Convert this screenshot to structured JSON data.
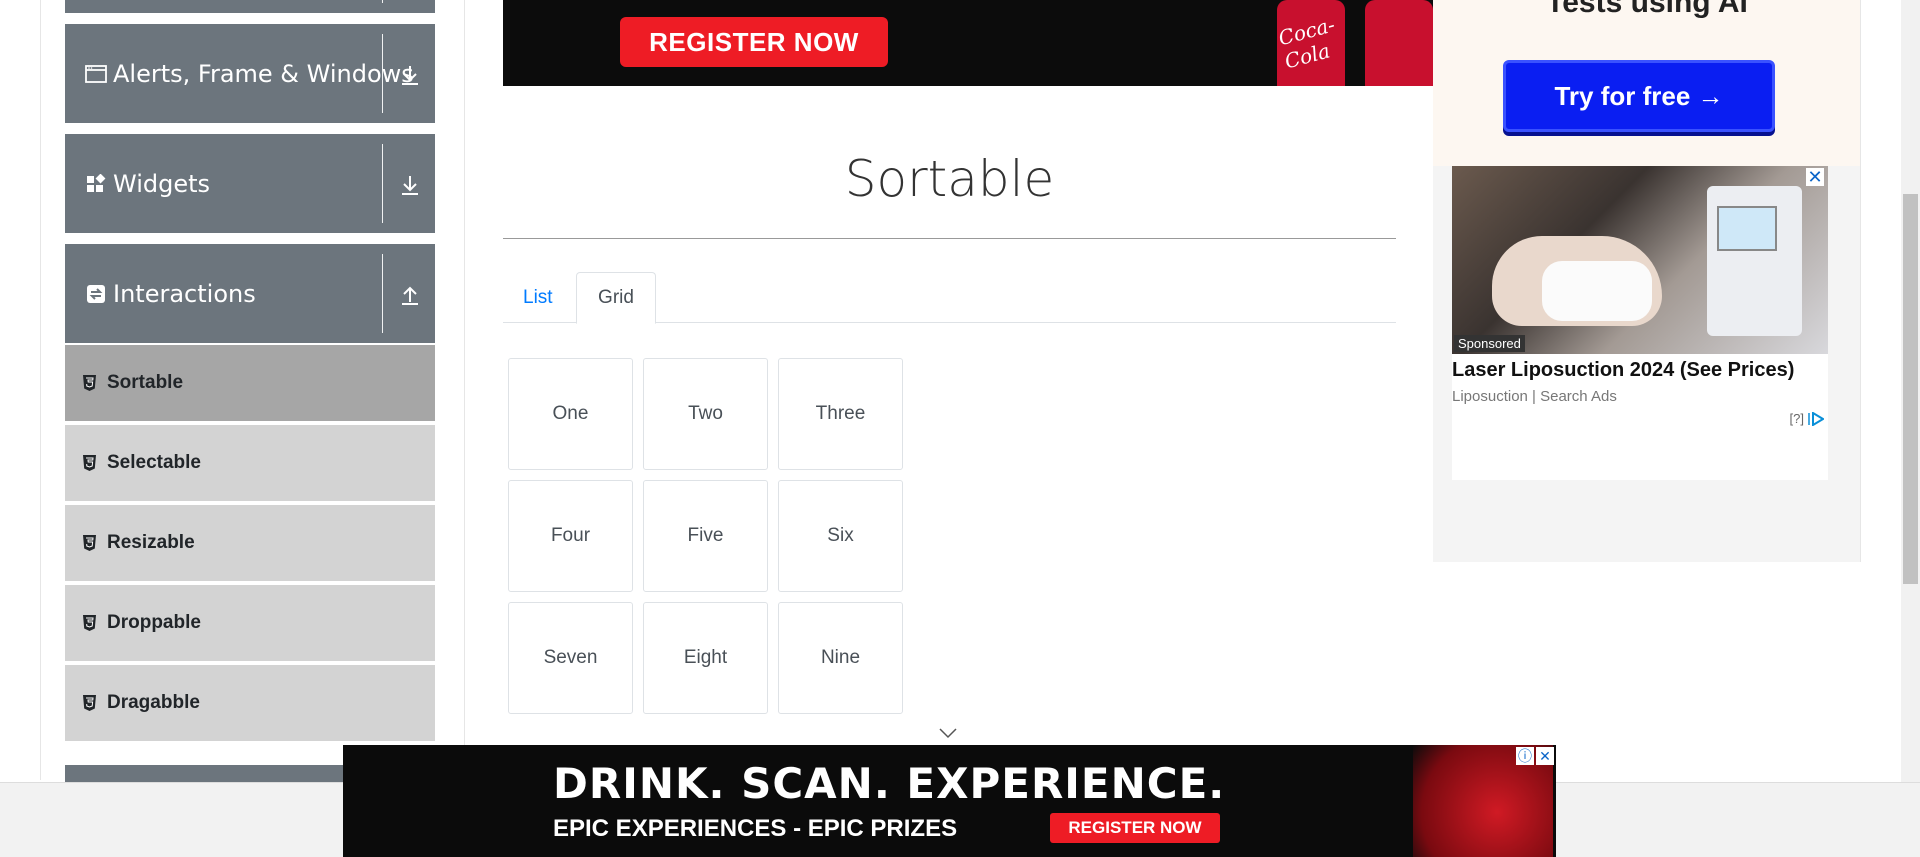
{
  "sidebar": {
    "groups": [
      {
        "label": "Alerts, Frame & Windows",
        "icon": "window-icon",
        "toggle_icon": "download-arrow-icon"
      },
      {
        "label": "Widgets",
        "icon": "widgets-grid-icon",
        "toggle_icon": "download-arrow-icon"
      },
      {
        "label": "Interactions",
        "icon": "interactions-icon",
        "toggle_icon": "upload-arrow-icon"
      }
    ],
    "items": [
      {
        "label": "Sortable",
        "active": true
      },
      {
        "label": "Selectable"
      },
      {
        "label": "Resizable"
      },
      {
        "label": "Droppable"
      },
      {
        "label": "Dragabble"
      }
    ]
  },
  "top_banner": {
    "cta": "REGISTER NOW",
    "brand": "Coca-Cola"
  },
  "main": {
    "title": "Sortable",
    "tabs": [
      {
        "label": "List",
        "active": false
      },
      {
        "label": "Grid",
        "active": true
      }
    ],
    "grid_items": [
      "One",
      "Two",
      "Three",
      "Four",
      "Five",
      "Six",
      "Seven",
      "Eight",
      "Nine"
    ]
  },
  "right_ad": {
    "headline": "Tests using AI",
    "cta": "Try for free →",
    "sponsored_badge": "Sponsored",
    "title": "Laser Liposuction 2024 (See Prices)",
    "source": "Liposuction | Search Ads",
    "choices": "[?]"
  },
  "bottom_banner": {
    "line1": "DRINK.  SCAN.  EXPERIENCE.",
    "line2": "EPIC EXPERIENCES - EPIC PRIZES",
    "cta": "REGISTER NOW"
  },
  "colors": {
    "sidebar_group_bg": "#6c757d",
    "menu_item_bg": "#d3d3d3",
    "menu_item_active_bg": "#a6a6a6",
    "link_blue": "#007bff",
    "ad_cta_blue": "#0a1ef2",
    "coke_red": "#ee1c25"
  }
}
